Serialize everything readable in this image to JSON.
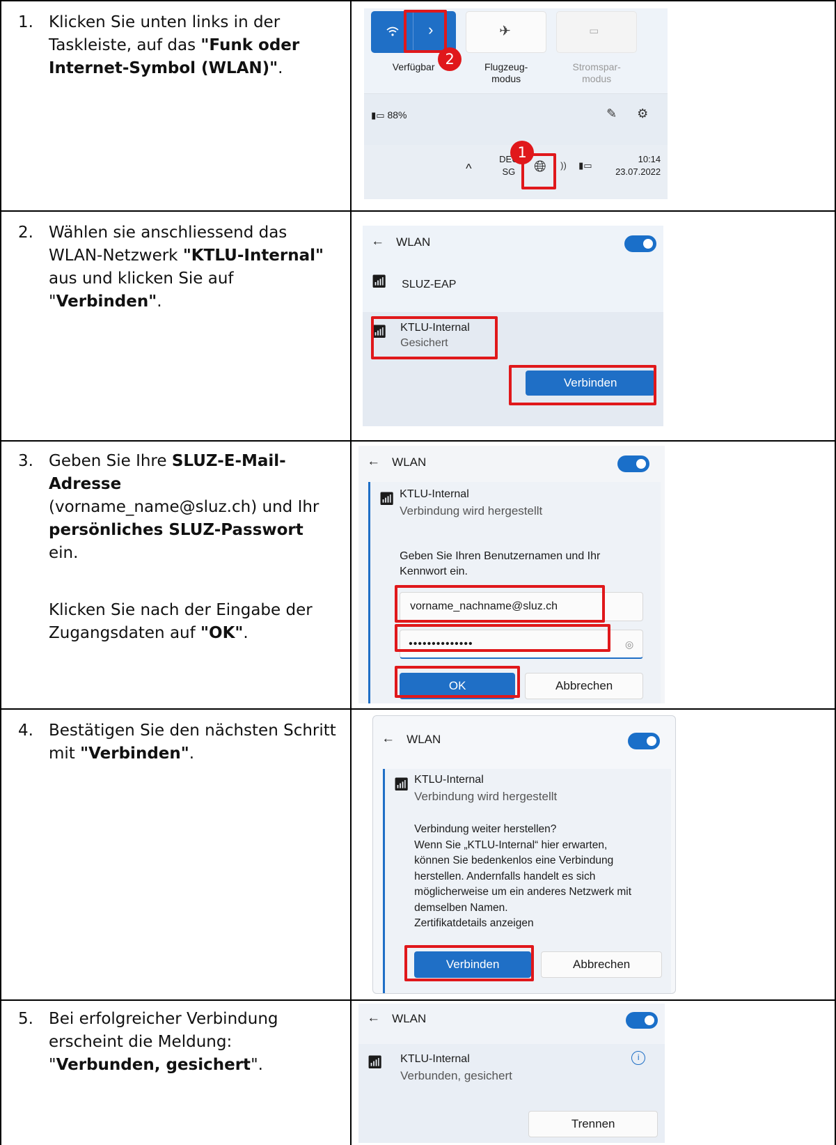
{
  "steps": [
    {
      "num": "1.",
      "text_parts": [
        "Klicken Sie unten links in der Taskleiste, auf das ",
        "\"Funk oder Internet-Symbol (WLAN)\"",
        "."
      ],
      "shot": {
        "tile_available": "Verfügbar",
        "tile_flight": "Flugzeug-",
        "tile_flight2": "modus",
        "tile_power": "Stromspar-",
        "tile_power2": "modus",
        "battery": "88%",
        "lang_top": "DEU",
        "lang_bottom": "SG",
        "time": "10:14",
        "date": "23.07.2022",
        "badge1": "1",
        "badge2": "2"
      }
    },
    {
      "num": "2.",
      "text_parts": [
        "Wählen sie anschliessend das WLAN-Netzwerk ",
        "\"KTLU-Internal\"",
        " aus und klicken Sie auf \"",
        "Verbinden\"",
        "."
      ],
      "shot": {
        "header": "WLAN",
        "net1": "SLUZ-EAP",
        "net2": "KTLU-Internal",
        "net2_status": "Gesichert",
        "connect": "Verbinden"
      }
    },
    {
      "num": "3.",
      "text_parts": [
        "Geben Sie Ihre ",
        "SLUZ-E-Mail-Adresse",
        " (vorname_name@sluz.ch) und Ihr ",
        "persönliches SLUZ-Passwort",
        " ein."
      ],
      "text2_parts": [
        "Klicken Sie nach der Eingabe der Zugangsdaten auf ",
        "\"OK\"",
        "."
      ],
      "shot": {
        "header": "WLAN",
        "net": "KTLU-Internal",
        "status": "Verbindung wird hergestellt",
        "prompt1": "Geben Sie Ihren Benutzernamen und Ihr",
        "prompt2": "Kennwort ein.",
        "username": "vorname_nachname@sluz.ch",
        "password": "••••••••••••••",
        "ok": "OK",
        "cancel": "Abbrechen"
      }
    },
    {
      "num": "4.",
      "text_parts": [
        "Bestätigen Sie den nächsten Schritt mit ",
        "\"Verbinden\"",
        "."
      ],
      "shot": {
        "header": "WLAN",
        "net": "KTLU-Internal",
        "status": "Verbindung wird hergestellt",
        "msg": [
          "Verbindung weiter herstellen?",
          "Wenn Sie „KTLU-Internal“ hier erwarten,",
          "können Sie bedenkenlos eine Verbindung",
          "herstellen. Andernfalls handelt es sich",
          "möglicherweise um ein anderes Netzwerk mit",
          "demselben Namen.",
          "Zertifikatdetails anzeigen"
        ],
        "connect": "Verbinden",
        "cancel": "Abbrechen"
      }
    },
    {
      "num": "5.",
      "text_parts": [
        "Bei erfolgreicher Verbindung erscheint die Meldung: \"",
        "Verbunden, gesichert",
        "\"."
      ],
      "shot": {
        "header": "WLAN",
        "net": "KTLU-Internal",
        "status": "Verbunden, gesichert",
        "disconnect": "Trennen"
      }
    }
  ]
}
